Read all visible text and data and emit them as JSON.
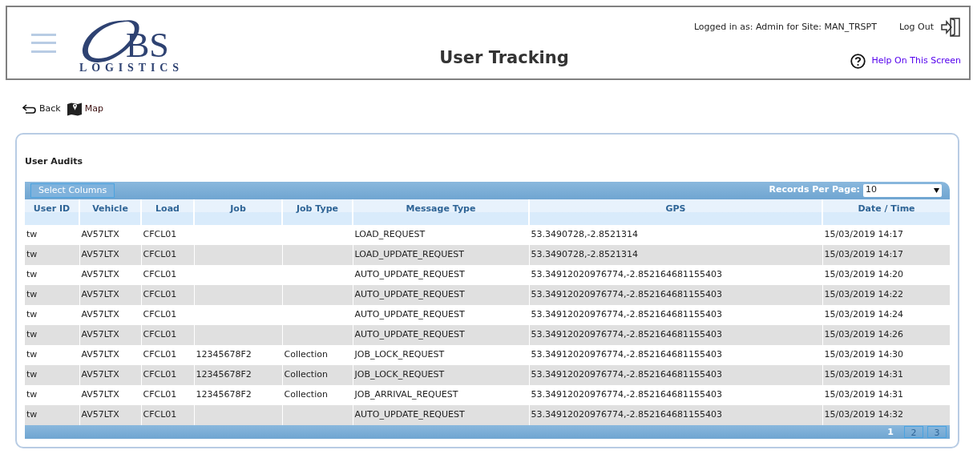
{
  "header": {
    "logo": {
      "letters": "BS",
      "tagline": "LOGISTICS"
    },
    "title": "User Tracking",
    "logged_in": "Logged in as: Admin for Site: MAN_TRSPT",
    "logout": "Log Out",
    "help": "Help On This Screen"
  },
  "toolbar": [
    {
      "kind": "back",
      "label": "Back"
    },
    {
      "kind": "map",
      "label": "Map"
    }
  ],
  "panel": {
    "title": "User Audits",
    "select_columns": "Select Columns",
    "records_label": "Records Per Page:",
    "records_value": "10"
  },
  "table": {
    "columns": [
      "User ID",
      "Vehicle",
      "Load",
      "Job",
      "Job Type",
      "Message Type",
      "GPS",
      "Date / Time"
    ],
    "rows": [
      [
        "tw",
        "AV57LTX",
        "CFCL01",
        "",
        "",
        "LOAD_REQUEST",
        "53.3490728,-2.8521314",
        "15/03/2019 14:17"
      ],
      [
        "tw",
        "AV57LTX",
        "CFCL01",
        "",
        "",
        "LOAD_UPDATE_REQUEST",
        "53.3490728,-2.8521314",
        "15/03/2019 14:17"
      ],
      [
        "tw",
        "AV57LTX",
        "CFCL01",
        "",
        "",
        "AUTO_UPDATE_REQUEST",
        "53.34912020976774,-2.852164681155403",
        "15/03/2019 14:20"
      ],
      [
        "tw",
        "AV57LTX",
        "CFCL01",
        "",
        "",
        "AUTO_UPDATE_REQUEST",
        "53.34912020976774,-2.852164681155403",
        "15/03/2019 14:22"
      ],
      [
        "tw",
        "AV57LTX",
        "CFCL01",
        "",
        "",
        "AUTO_UPDATE_REQUEST",
        "53.34912020976774,-2.852164681155403",
        "15/03/2019 14:24"
      ],
      [
        "tw",
        "AV57LTX",
        "CFCL01",
        "",
        "",
        "AUTO_UPDATE_REQUEST",
        "53.34912020976774,-2.852164681155403",
        "15/03/2019 14:26"
      ],
      [
        "tw",
        "AV57LTX",
        "CFCL01",
        "12345678F2",
        "Collection",
        "JOB_LOCK_REQUEST",
        "53.34912020976774,-2.852164681155403",
        "15/03/2019 14:30"
      ],
      [
        "tw",
        "AV57LTX",
        "CFCL01",
        "12345678F2",
        "Collection",
        "JOB_LOCK_REQUEST",
        "53.34912020976774,-2.852164681155403",
        "15/03/2019 14:31"
      ],
      [
        "tw",
        "AV57LTX",
        "CFCL01",
        "12345678F2",
        "Collection",
        "JOB_ARRIVAL_REQUEST",
        "53.34912020976774,-2.852164681155403",
        "15/03/2019 14:31"
      ],
      [
        "tw",
        "AV57LTX",
        "CFCL01",
        "",
        "",
        "AUTO_UPDATE_REQUEST",
        "53.34912020976774,-2.852164681155403",
        "15/03/2019 14:32"
      ]
    ]
  },
  "pagination": [
    {
      "label": "1",
      "selected": true
    },
    {
      "label": "2",
      "selected": false
    },
    {
      "label": "3",
      "selected": false
    }
  ]
}
